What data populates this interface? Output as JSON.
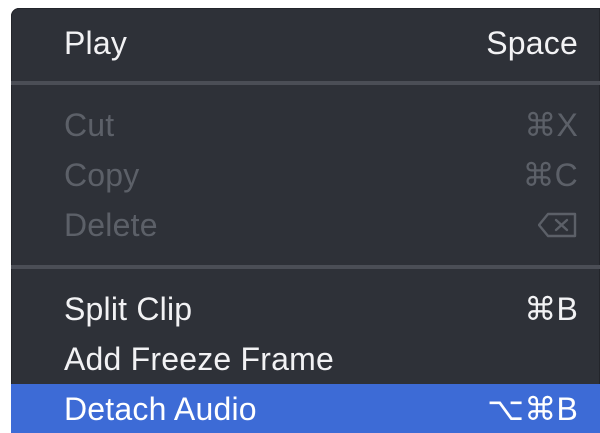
{
  "menu": {
    "items": [
      {
        "label": "Play",
        "shortcut": "Space",
        "state": "enabled"
      },
      {
        "label": "Cut",
        "shortcut": "⌘X",
        "state": "disabled"
      },
      {
        "label": "Copy",
        "shortcut": "⌘C",
        "state": "disabled"
      },
      {
        "label": "Delete",
        "shortcut_icon": "delete-backward-icon",
        "state": "disabled"
      },
      {
        "label": "Split Clip",
        "shortcut": "⌘B",
        "state": "enabled"
      },
      {
        "label": "Add Freeze Frame",
        "shortcut": "",
        "state": "enabled"
      },
      {
        "label": "Detach Audio",
        "shortcut": "⌥⌘B",
        "state": "selected"
      }
    ]
  },
  "colors": {
    "menu_background": "#2e3138",
    "separator": "#4b4e56",
    "enabled_text": "#f2f2f4",
    "disabled_text": "#5c6068",
    "selection_highlight": "#3d6bd6"
  }
}
